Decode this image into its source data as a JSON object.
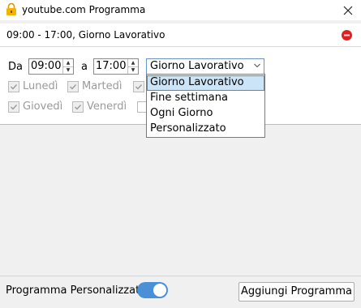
{
  "window": {
    "title": "youtube.com Programma",
    "close_icon": "close-icon"
  },
  "schedule": {
    "summary": "09:00 - 17:00, Giorno Lavorativo",
    "remove_color": "#e02020"
  },
  "editor": {
    "from_label": "Da",
    "from_time": "09:00",
    "to_label": "a",
    "to_time": "17:00",
    "select_value": "Giorno Lavorativo",
    "dropdown_options": [
      "Giorno Lavorativo",
      "Fine settimana",
      "Ogni Giorno",
      "Personalizzato"
    ],
    "days": [
      {
        "label": "Lunedì",
        "checked": true
      },
      {
        "label": "Martedì",
        "checked": true
      },
      {
        "label": "Giovedì",
        "checked": true
      },
      {
        "label": "Venerdì",
        "checked": true
      }
    ]
  },
  "footer": {
    "toggle_label": "Programma Personalizzato",
    "toggle_on": true,
    "add_button_label": "Aggiungi Programma",
    "accent": "#4a90d9"
  }
}
